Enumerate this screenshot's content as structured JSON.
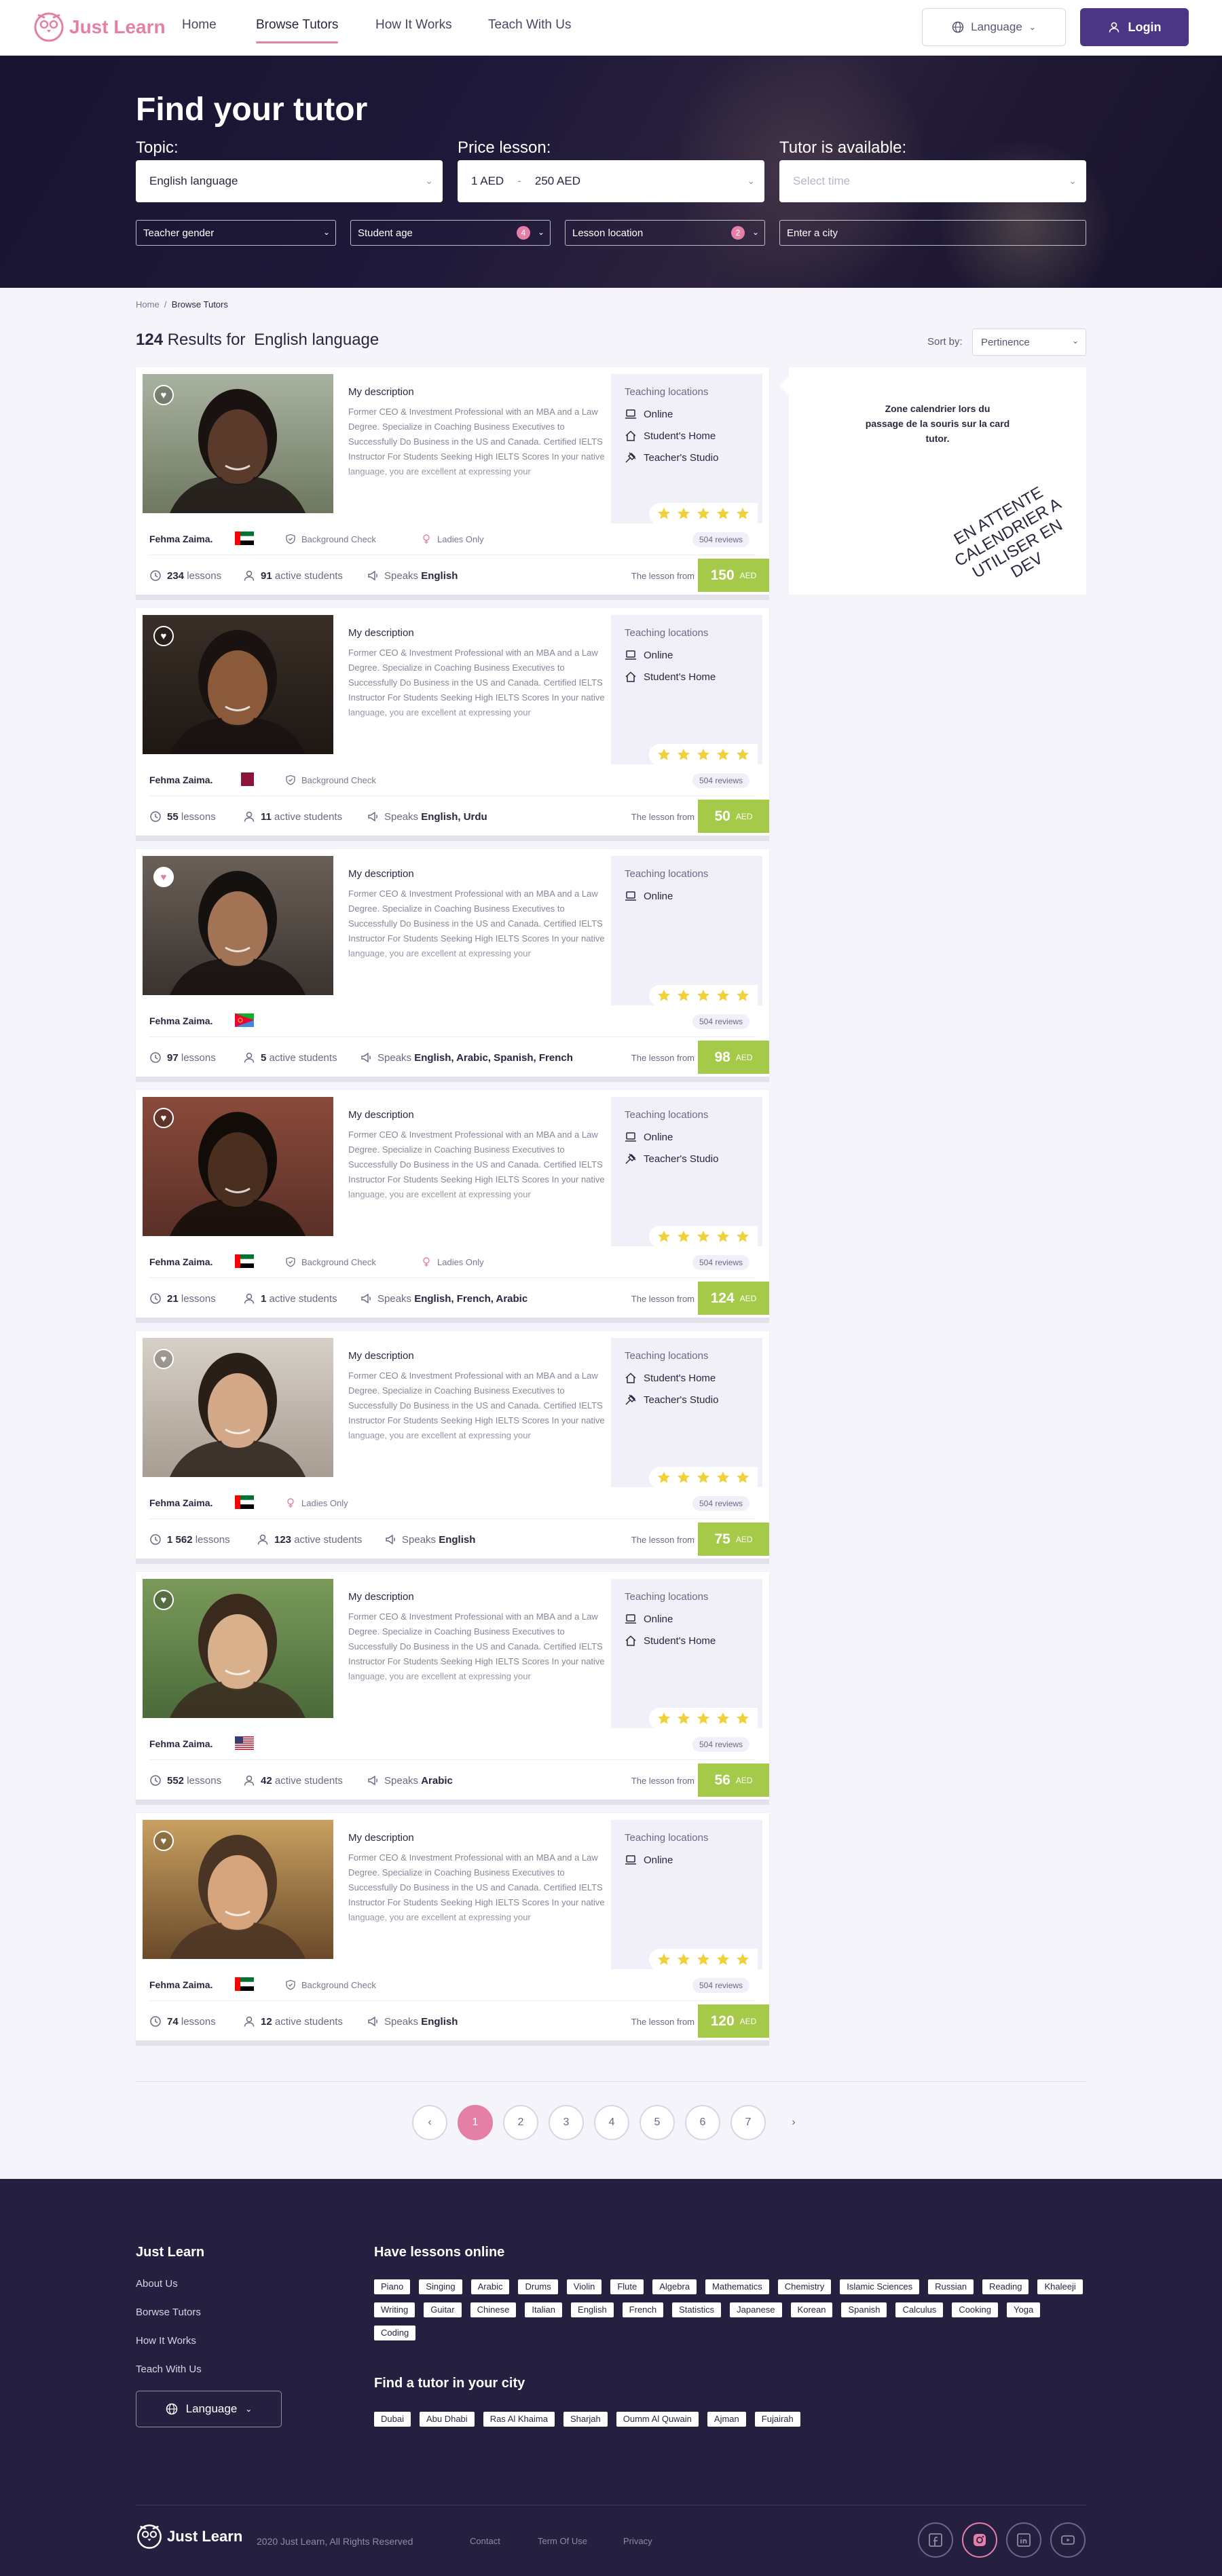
{
  "nav": {
    "brand": "Just Learn",
    "links": [
      "Home",
      "Browse Tutors",
      "How It Works",
      "Teach With Us"
    ],
    "language": "Language",
    "login": "Login"
  },
  "hero": {
    "title": "Find your tutor",
    "topic_label": "Topic:",
    "topic_value": "English language",
    "price_label": "Price lesson:",
    "price_min": "1 AED",
    "price_sep": "-",
    "price_max": "250 AED",
    "available_label": "Tutor is available:",
    "available_placeholder": "Select time",
    "filters": {
      "gender": "Teacher gender",
      "age": "Student age",
      "age_count": "4",
      "location": "Lesson location",
      "location_count": "2",
      "city_placeholder": "Enter a city"
    }
  },
  "breadcrumb": {
    "home": "Home",
    "sep": "/",
    "current": "Browse Tutors"
  },
  "results": {
    "count": "124",
    "label": "Results for",
    "topic": "English language"
  },
  "sort": {
    "label": "Sort by:",
    "value": "Pertinence"
  },
  "card_common": {
    "desc_title": "My description",
    "desc_text": "Former CEO & Investment Professional with an MBA and a Law Degree. Specialize in Coaching Business Executives to Successfully Do Business in the US and Canada. Certified IELTS Instructor For Students Seeking High IELTS Scores In your native language, you are excellent at expressing your",
    "tl_title": "Teaching locations",
    "from": "The lesson from",
    "currency": "AED"
  },
  "tutors": [
    {
      "name": "Fehma Zaima.",
      "flag": "uae",
      "bg_check": "Background Check",
      "ladies": "Ladies Only",
      "locations": [
        "Online",
        "Student's Home",
        "Teacher's Studio"
      ],
      "reviews": "504 reviews",
      "rating": 5,
      "lessons": "234",
      "lessons_label": "lessons",
      "students": "91",
      "students_label": "active students",
      "speaks_label": "Speaks",
      "speaks": "English",
      "price": "150",
      "fav": false
    },
    {
      "name": "Fehma Zaima.",
      "flag": "qatar",
      "bg_check": "Background Check",
      "ladies": "",
      "locations": [
        "Online",
        "Student's Home"
      ],
      "reviews": "504 reviews",
      "rating": 5,
      "lessons": "55",
      "lessons_label": "lessons",
      "students": "11",
      "students_label": "active students",
      "speaks_label": "Speaks",
      "speaks": "English, Urdu",
      "price": "50",
      "fav": false
    },
    {
      "name": "Fehma Zaima.",
      "flag": "eritrea",
      "bg_check": "",
      "ladies": "",
      "locations": [
        "Online"
      ],
      "reviews": "504 reviews",
      "rating": 5,
      "lessons": "97",
      "lessons_label": "lessons",
      "students": "5",
      "students_label": "active students",
      "speaks_label": "Speaks",
      "speaks": "English, Arabic, Spanish, French",
      "price": "98",
      "fav": true
    },
    {
      "name": "Fehma Zaima.",
      "flag": "uae",
      "bg_check": "Background Check",
      "ladies": "Ladies Only",
      "locations": [
        "Online",
        "Teacher's Studio"
      ],
      "reviews": "504 reviews",
      "rating": 5,
      "lessons": "21",
      "lessons_label": "lessons",
      "students": "1",
      "students_label": "active students",
      "speaks_label": "Speaks",
      "speaks": "English, French, Arabic",
      "price": "124",
      "fav": false
    },
    {
      "name": "Fehma Zaima.",
      "flag": "uae",
      "bg_check": "",
      "ladies": "Ladies Only",
      "locations": [
        "Student's Home",
        "Teacher's Studio"
      ],
      "reviews": "504 reviews",
      "rating": 5,
      "lessons": "1 562",
      "lessons_label": "lessons",
      "students": "123",
      "students_label": "active students",
      "speaks_label": "Speaks",
      "speaks": "English",
      "price": "75",
      "fav": false
    },
    {
      "name": "Fehma Zaima.",
      "flag": "usa",
      "bg_check": "",
      "ladies": "",
      "locations": [
        "Online",
        "Student's Home"
      ],
      "reviews": "504 reviews",
      "rating": 5,
      "lessons": "552",
      "lessons_label": "lessons",
      "students": "42",
      "students_label": "active students",
      "speaks_label": "Speaks",
      "speaks": "Arabic",
      "price": "56",
      "fav": false
    },
    {
      "name": "Fehma Zaima.",
      "flag": "uae",
      "bg_check": "Background Check",
      "ladies": "",
      "locations": [
        "Online"
      ],
      "reviews": "504 reviews",
      "rating": 5,
      "lessons": "74",
      "lessons_label": "lessons",
      "students": "12",
      "students_label": "active students",
      "speaks_label": "Speaks",
      "speaks": "English",
      "price": "120",
      "fav": false
    }
  ],
  "calendar": {
    "text": "Zone calendrier lors du passage de la souris sur la card tutor.",
    "wip": "EN ATTENTE CALENDRIER A UTILISER EN DEV"
  },
  "pagination": {
    "prev": "‹",
    "pages": [
      "1",
      "2",
      "3",
      "4",
      "5",
      "6",
      "7"
    ],
    "current": "1",
    "next": "›"
  },
  "footer": {
    "brand_title": "Just Learn",
    "links": [
      "About Us",
      "Borwse Tutors",
      "How It Works",
      "Teach With Us"
    ],
    "language": "Language",
    "online_title": "Have lessons online",
    "online_tags": [
      "Piano",
      "Singing",
      "Arabic",
      "Drums",
      "Violin",
      "Flute",
      "Algebra",
      "Mathematics",
      "Chemistry",
      "Islamic Sciences",
      "Russian",
      "Reading",
      "Khaleeji",
      "Writing",
      "Guitar",
      "Chinese",
      "Italian",
      "English",
      "French",
      "Statistics",
      "Japanese",
      "Korean",
      "Spanish",
      "Calculus",
      "Cooking",
      "Yoga",
      "Coding"
    ],
    "city_title": "Find a tutor in your city",
    "city_tags": [
      "Dubai",
      "Abu Dhabi",
      "Ras Al Khaima",
      "Sharjah",
      "Oumm Al Quwain",
      "Ajman",
      "Fujairah"
    ],
    "logo_text": "Just Learn",
    "copyright": "2020 Just Learn, All Rights Reserved",
    "contact": "Contact",
    "terms": "Term Of Use",
    "privacy": "Privacy",
    "social": [
      "facebook-icon",
      "instagram-icon",
      "linkedin-icon",
      "youtube-icon"
    ]
  },
  "colors": {
    "brand_pink": "#e47fa6",
    "brand_purple": "#4b3585",
    "price_green": "#a5c948",
    "footer_bg": "#262040",
    "star_yellow": "#f1d13a"
  }
}
